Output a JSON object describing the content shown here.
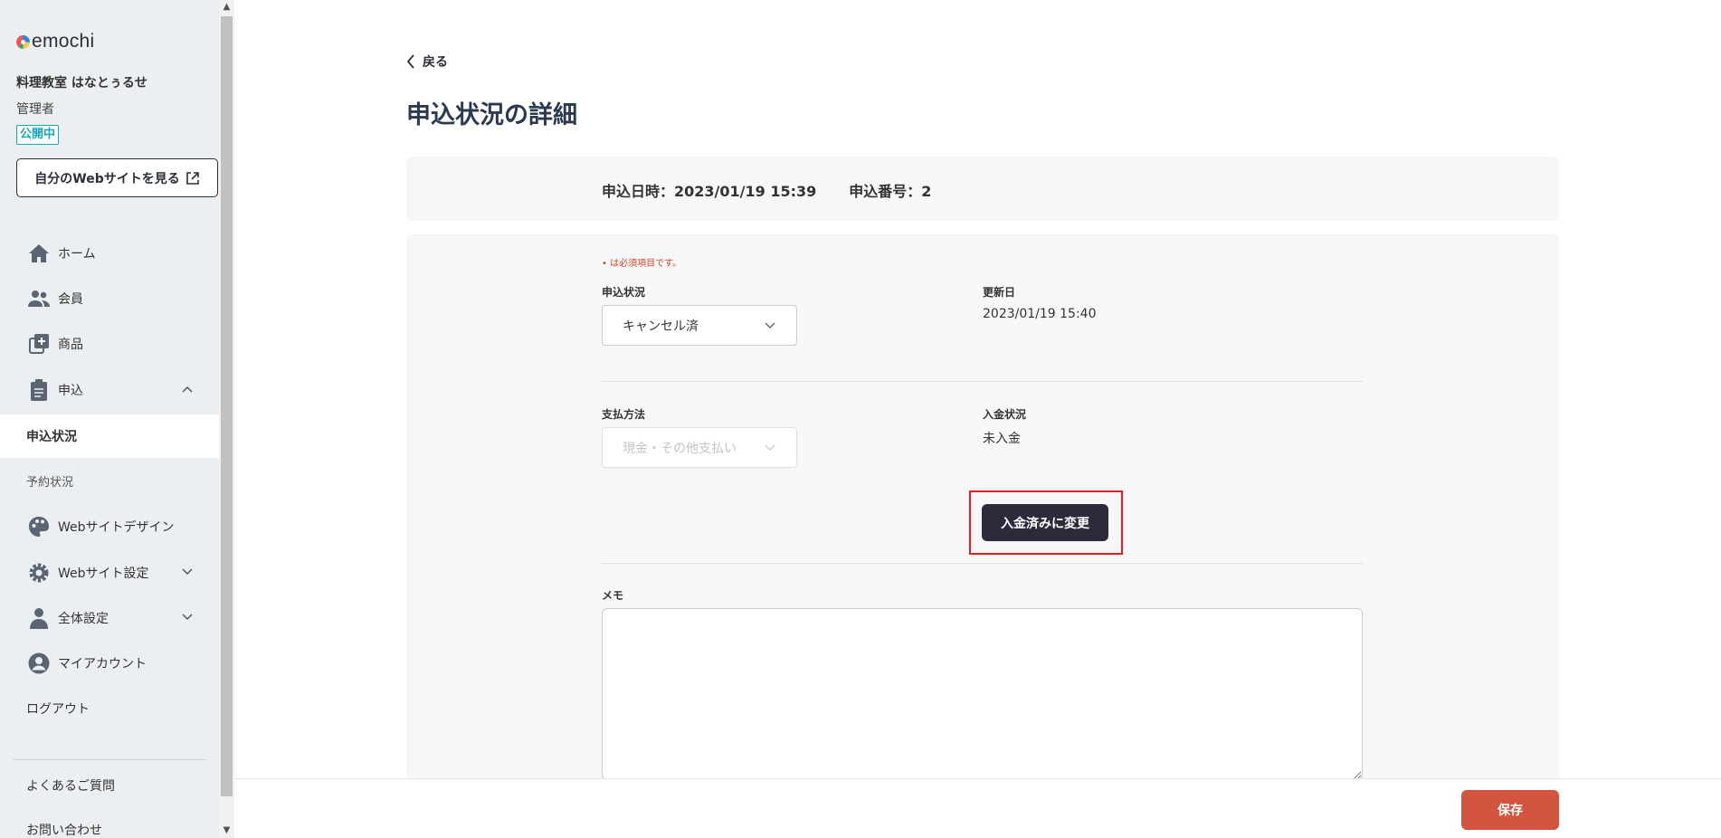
{
  "sidebar": {
    "logo_text": "emochi",
    "org_name": "料理教室 はなとぅるせ",
    "role": "管理者",
    "status_badge": "公開中",
    "view_site_button": "自分のWebサイトを見る",
    "nav": {
      "home": "ホーム",
      "members": "会員",
      "products": "商品",
      "applications": "申込",
      "application_status": "申込状況",
      "reservation_status": "予約状況",
      "website_design": "Webサイトデザイン",
      "website_settings": "Webサイト設定",
      "global_settings": "全体設定",
      "my_account": "マイアカウント",
      "logout": "ログアウト",
      "faq": "よくあるご質問",
      "contact": "お問い合わせ"
    }
  },
  "main": {
    "back_label": "戻る",
    "page_title": "申込状況の詳細",
    "info": {
      "applied_at": "申込日時：2023/01/19 15:39",
      "application_number": "申込番号：2"
    },
    "form": {
      "required_note": "• は必須項目です。",
      "status_label": "申込状況",
      "status_value": "キャンセル済",
      "updated_label": "更新日",
      "updated_value": "2023/01/19 15:40",
      "payment_method_label": "支払方法",
      "payment_method_value": "現金・その他支払い",
      "payment_status_label": "入金状況",
      "payment_status_value": "未入金",
      "mark_paid_button": "入金済みに変更",
      "memo_label": "メモ",
      "memo_value": ""
    },
    "save_button": "保存"
  },
  "colors": {
    "accent": "#d4553f",
    "dark_button": "#2b2b3c",
    "badge": "#18a7b5",
    "highlight": "#e02020"
  }
}
